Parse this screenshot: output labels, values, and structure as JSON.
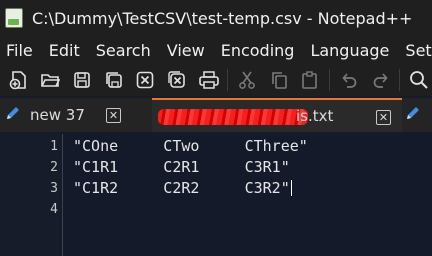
{
  "window": {
    "title": "C:\\Dummy\\TestCSV\\test-temp.csv - Notepad++"
  },
  "menu": [
    "File",
    "Edit",
    "Search",
    "View",
    "Encoding",
    "Language",
    "Settin"
  ],
  "toolbar": [
    "new-file-icon",
    "open-file-icon",
    "save-icon",
    "save-all-icon",
    "close-icon",
    "close-all-icon",
    "print-icon",
    "cut-icon",
    "copy-icon",
    "paste-icon",
    "undo-icon",
    "redo-icon",
    "find-icon"
  ],
  "tabs": [
    {
      "label": "new 37"
    },
    {
      "label": "is.txt"
    }
  ],
  "editor": {
    "lines": [
      {
        "number": "1",
        "text": "\"COne     CTwo     CThree\""
      },
      {
        "number": "2",
        "text": "\"C1R1     C2R1     C3R1\""
      },
      {
        "number": "3",
        "text": "\"C1R2     C2R2     C3R2\""
      },
      {
        "number": "4",
        "text": ""
      }
    ]
  },
  "colors": {
    "accent_tab": "#e8762b",
    "redaction": "#ff2020"
  }
}
